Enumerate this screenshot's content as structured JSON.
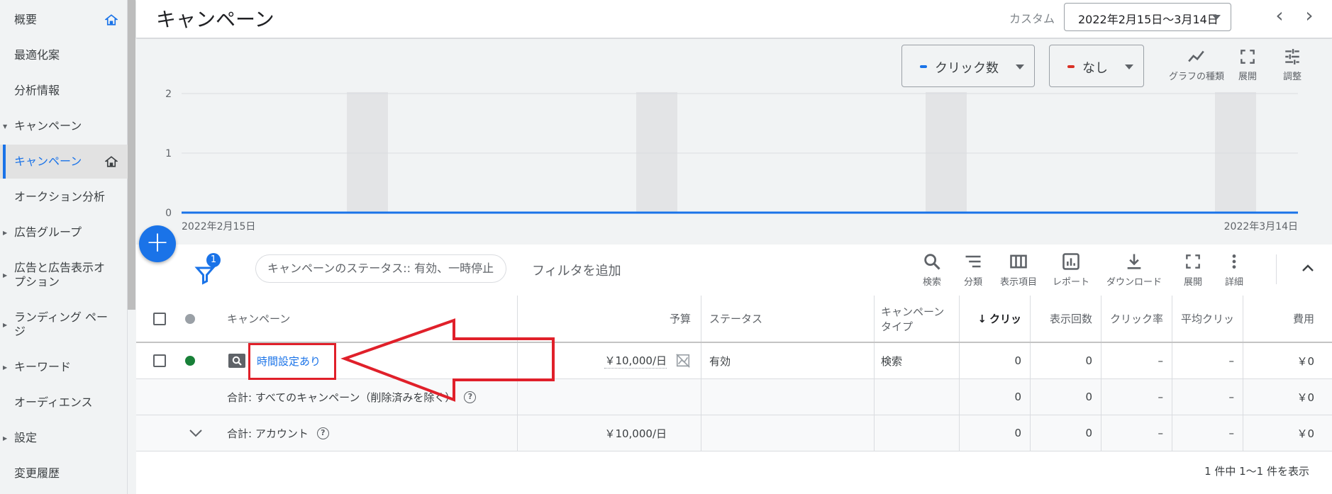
{
  "sidebar": {
    "items": [
      {
        "label": "概要",
        "home": true
      },
      {
        "label": "最適化案"
      },
      {
        "label": "分析情報"
      },
      {
        "label": "キャンペーン",
        "expanded": true
      },
      {
        "label": "キャンペーン",
        "active": true,
        "home": true
      },
      {
        "label": "オークション分析"
      },
      {
        "label": "広告グループ",
        "caret": true
      },
      {
        "label": "広告と広告表示オプション",
        "caret": true
      },
      {
        "label": "ランディング ページ",
        "caret": true
      },
      {
        "label": "キーワード",
        "caret": true
      },
      {
        "label": "オーディエンス"
      },
      {
        "label": "設定",
        "caret": true
      },
      {
        "label": "変更履歴"
      }
    ]
  },
  "header": {
    "title": "キャンペーン",
    "date_label": "カスタム",
    "date_range": "2022年2月15日～3月14日"
  },
  "chart_controls": {
    "metric1": {
      "label": "クリック数",
      "color": "#1a73e8"
    },
    "metric2": {
      "label": "なし",
      "color": "#d93025"
    },
    "tools": [
      "グラフの種類",
      "展開",
      "調整"
    ]
  },
  "chart_data": {
    "type": "line",
    "x_start_label": "2022年2月15日",
    "x_end_label": "2022年3月14日",
    "y_ticks": [
      0,
      1,
      2
    ],
    "ylim": [
      0,
      2
    ],
    "series": [
      {
        "name": "クリック数",
        "values": [
          0,
          0
        ]
      }
    ],
    "grid": true
  },
  "toolbar": {
    "filter_count": "1",
    "filter_chip": "キャンペーンのステータス:: 有効、一時停止",
    "add_filter": "フィルタを追加",
    "tools": [
      "検索",
      "分類",
      "表示項目",
      "レポート",
      "ダウンロード",
      "展開",
      "詳細"
    ]
  },
  "table": {
    "headers": {
      "campaign": "キャンペーン",
      "budget": "予算",
      "status": "ステータス",
      "type_line1": "キャンペーン",
      "type_line2": "タイプ",
      "clicks": "クリッ",
      "impressions": "表示回数",
      "ctr": "クリック率",
      "avg_cpc": "平均クリッ",
      "cost": "費用"
    },
    "row1": {
      "campaign": "時間設定あり",
      "budget": "￥10,000/日",
      "status": "有効",
      "type": "検索",
      "clicks": "0",
      "impressions": "0",
      "ctr": "–",
      "avg_cpc": "–",
      "cost": "￥0"
    },
    "row2": {
      "campaign": "合計: すべてのキャンペーン（削除済みを除く）",
      "clicks": "0",
      "impressions": "0",
      "ctr": "–",
      "avg_cpc": "–",
      "cost": "￥0"
    },
    "row3": {
      "campaign": "合計: アカウント",
      "budget": "￥10,000/日",
      "clicks": "0",
      "impressions": "0",
      "ctr": "–",
      "avg_cpc": "–",
      "cost": "￥0"
    },
    "pagination": "1 件中 1～1 件を表示",
    "colors": {
      "enabled": "#188038",
      "header_dot": "#9aa0a6",
      "annotation": "#e0202a"
    }
  }
}
